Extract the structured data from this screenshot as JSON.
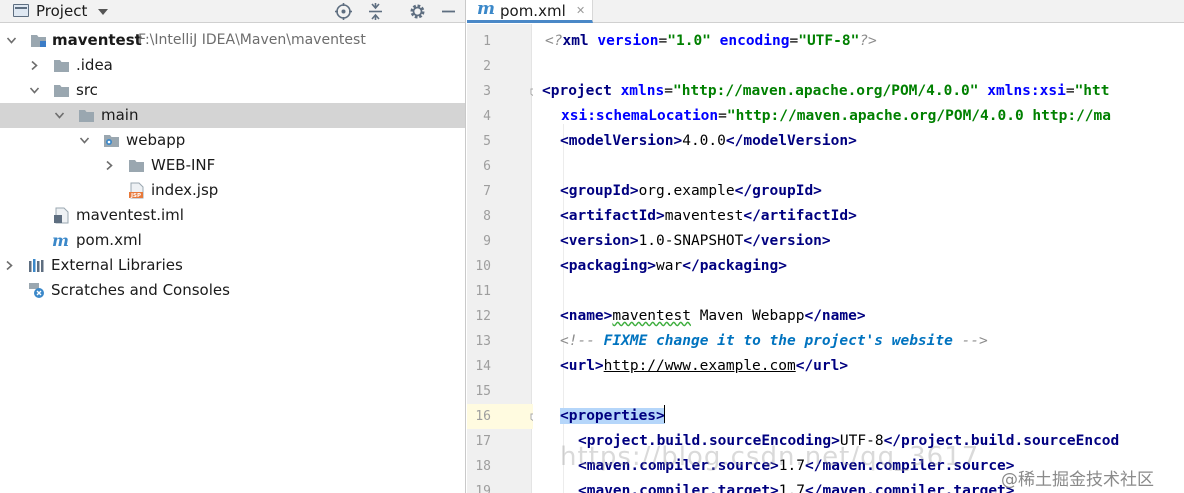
{
  "project_pane": {
    "title": "Project",
    "tree": [
      {
        "label": "maventest",
        "path": "F:\\IntelliJ IDEA\\Maven\\maventest",
        "bold": true,
        "expanded": true
      },
      {
        "label": ".idea",
        "expanded": false
      },
      {
        "label": "src",
        "expanded": true
      },
      {
        "label": "main",
        "expanded": true,
        "selected": true
      },
      {
        "label": "webapp",
        "expanded": true
      },
      {
        "label": "WEB-INF",
        "expanded": false
      },
      {
        "label": "index.jsp",
        "icon_badge": "JSP"
      },
      {
        "label": "maventest.iml"
      },
      {
        "label": "pom.xml",
        "icon_badge": "m"
      },
      {
        "label": "External Libraries",
        "expanded": false
      },
      {
        "label": "Scratches and Consoles"
      }
    ]
  },
  "editor": {
    "tab": {
      "label": "pom.xml",
      "icon_badge": "m"
    },
    "line_numbers": [
      "1",
      "2",
      "3",
      "4",
      "5",
      "6",
      "7",
      "8",
      "9",
      "10",
      "11",
      "12",
      "13",
      "14",
      "15",
      "16",
      "17",
      "18",
      "19"
    ],
    "current_line": "16",
    "code": {
      "l1_pi_open": "<?",
      "l1_xml": "xml",
      "l1_version_attr": "version",
      "l1_version_val": "\"1.0\"",
      "l1_encoding_attr": "encoding",
      "l1_encoding_val": "\"UTF-8\"",
      "l1_pi_close": "?>",
      "l3_open": "<project",
      "l3_xmlns_attr": "xmlns",
      "l3_xmlns_val": "\"http://maven.apache.org/POM/4.0.0\"",
      "l3_xsi_attr": "xmlns:xsi",
      "l3_xsi_val": "\"htt",
      "l4_schema_attr": "xsi:schemaLocation",
      "l4_schema_val": "\"http://maven.apache.org/POM/4.0.0 http://ma",
      "l5_open": "<modelVersion>",
      "l5_val": "4.0.0",
      "l5_close": "</modelVersion>",
      "l7_open": "<groupId>",
      "l7_val": "org.example",
      "l7_close": "</groupId>",
      "l8_open": "<artifactId>",
      "l8_val": "maventest",
      "l8_close": "</artifactId>",
      "l9_open": "<version>",
      "l9_val": "1.0-SNAPSHOT",
      "l9_close": "</version>",
      "l10_open": "<packaging>",
      "l10_val": "war",
      "l10_close": "</packaging>",
      "l12_open": "<name>",
      "l12_val_a": "maventest",
      "l12_val_b": " Maven Webapp",
      "l12_close": "</name>",
      "l13_comment_open": "<!--",
      "l13_fixme": "FIXME",
      "l13_comment_text": " change it to the project's website ",
      "l13_comment_close": "-->",
      "l14_open": "<url>",
      "l14_val": "http://www.example.com",
      "l14_close": "</url>",
      "l16_open": "<properties>",
      "l17_open": "<project.build.sourceEncoding>",
      "l17_val": "UTF-8",
      "l17_close": "</project.build.sourceEncod",
      "l18_open": "<maven.compiler.source>",
      "l18_val": "1.7",
      "l18_close": "</maven.compiler.source>",
      "l19_open": "<maven.compiler.target>",
      "l19_val": "1.7",
      "l19_close": "</maven.compiler.target>"
    }
  },
  "watermark": {
    "url": "https://blog.csdn.net/qq_3617",
    "site": "@稀土掘金技术社区"
  }
}
